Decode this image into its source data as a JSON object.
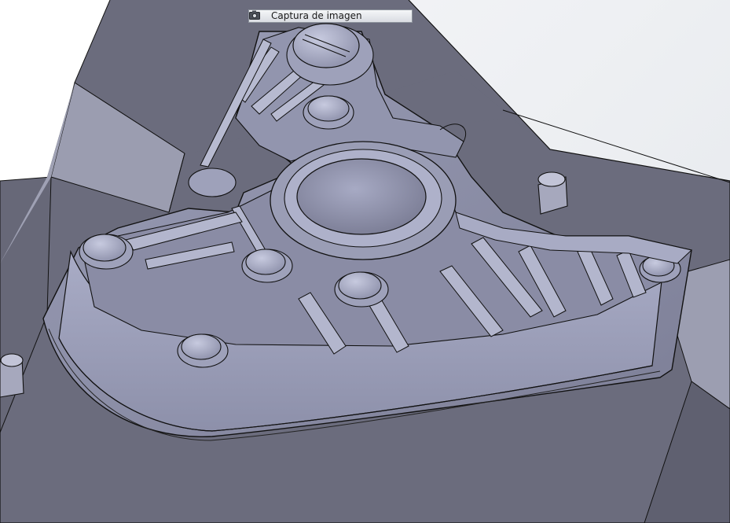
{
  "viewport": {
    "model_name": "mold-cavity-part",
    "colors": {
      "background": "#f2f3f5",
      "plate_top": "#6c6d7e",
      "plate_side_light": "#9b9daf",
      "plate_side_dark": "#5a5b69",
      "cavity_floor": "#8e90a8",
      "cavity_wall": "#a2a5bf",
      "feature_light": "#b9bcd3",
      "edge_line": "#111111"
    }
  },
  "capture_tooltip": {
    "icon": "camera-icon",
    "label": "Captura de imagen"
  }
}
